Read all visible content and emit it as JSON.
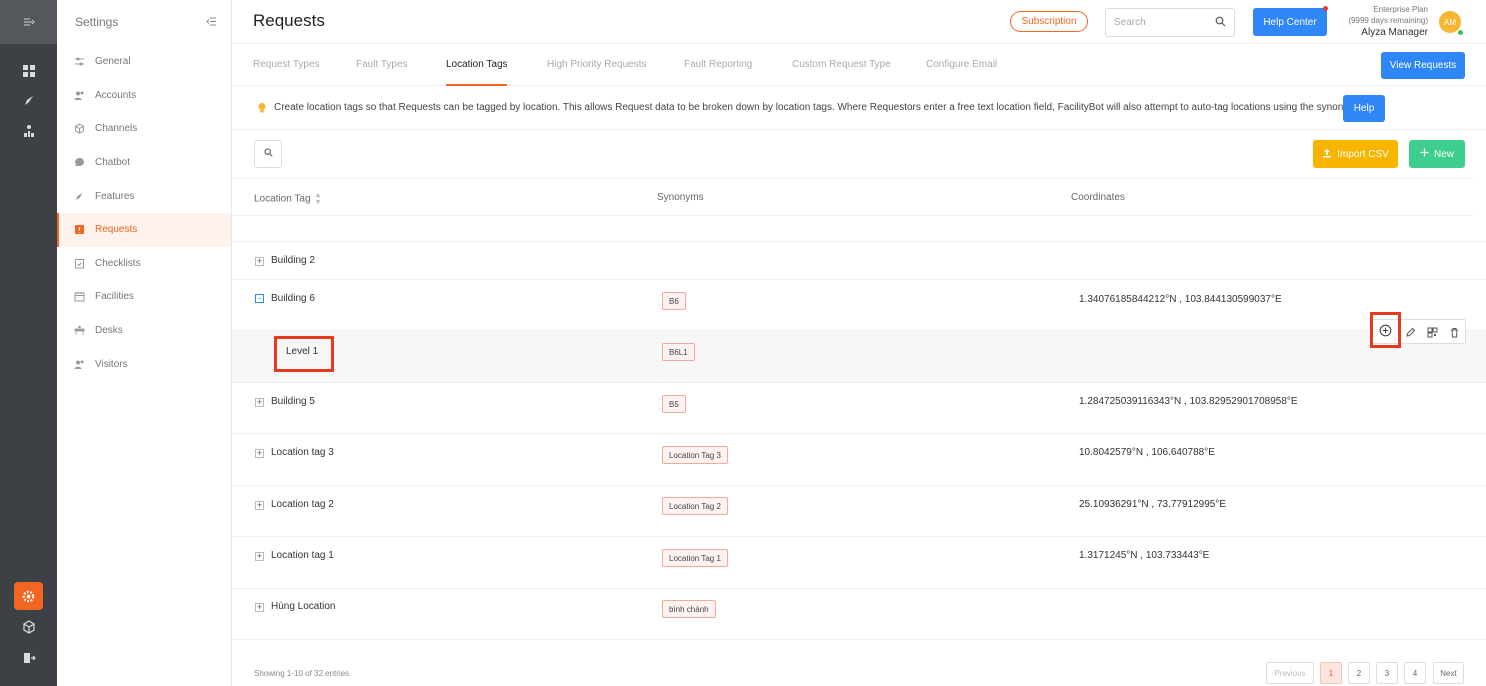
{
  "settings": {
    "title": "Settings",
    "menu": [
      {
        "label": "General",
        "icon": "sliders-icon"
      },
      {
        "label": "Accounts",
        "icon": "users-icon"
      },
      {
        "label": "Channels",
        "icon": "cube-icon"
      },
      {
        "label": "Chatbot",
        "icon": "chat-icon"
      },
      {
        "label": "Features",
        "icon": "rocket-icon"
      },
      {
        "label": "Requests",
        "icon": "request-icon"
      },
      {
        "label": "Checklists",
        "icon": "checklist-icon"
      },
      {
        "label": "Facilities",
        "icon": "calendar-icon"
      },
      {
        "label": "Desks",
        "icon": "desk-icon"
      },
      {
        "label": "Visitors",
        "icon": "visitor-icon"
      }
    ]
  },
  "header": {
    "title": "Requests",
    "subscription": "Subscription",
    "search_placeholder": "Search",
    "help_center": "Help Center",
    "plan": "Enterprise Plan",
    "plan_days": "(9999 days remaining)",
    "user_name": "Alyza Manager",
    "avatar_initials": "AM"
  },
  "tabs": [
    "Request Types",
    "Fault Types",
    "Location Tags",
    "High Priority Requests",
    "Fault Reporting",
    "Custom Request Type",
    "Configure Email"
  ],
  "view_requests": "View Requests",
  "info": {
    "text": "Create location tags so that Requests can be tagged by location. This allows Request data to be broken down by location tags. Where Requestors enter a free text location field, FacilityBot will also attempt to auto-tag locations using the synonyms.",
    "help": "Help"
  },
  "toolbar": {
    "import_csv": "Import CSV",
    "new": "New"
  },
  "table": {
    "columns": [
      "Location Tag",
      "Synonyms",
      "Coordinates"
    ],
    "rows": [
      {
        "name": "Building 2",
        "synonym": "",
        "coords": ""
      },
      {
        "name": "Building 6",
        "synonym": "B6",
        "coords": "1.34076185844212°N , 103.844130599037°E"
      },
      {
        "name": "Level 1",
        "synonym": "B6L1",
        "coords": ""
      },
      {
        "name": "Building 5",
        "synonym": "B5",
        "coords": "1.284725039116343°N , 103.82952901708958°E"
      },
      {
        "name": "Location tag 3",
        "synonym": "Location Tag 3",
        "coords": "10.8042579°N , 106.640788°E"
      },
      {
        "name": "Location tag 2",
        "synonym": "Location Tag 2",
        "coords": "25.10936291°N , 73.77912995°E"
      },
      {
        "name": "Location tag 1",
        "synonym": "Location Tag 1",
        "coords": "1.3171245°N , 103.733443°E"
      },
      {
        "name": "Hùng Location",
        "synonym": "bình chánh",
        "coords": ""
      }
    ]
  },
  "pagination": {
    "showing": "Showing 1-10 of 32 entries",
    "previous": "Previous",
    "pages": [
      "1",
      "2",
      "3",
      "4"
    ],
    "next": "Next"
  }
}
